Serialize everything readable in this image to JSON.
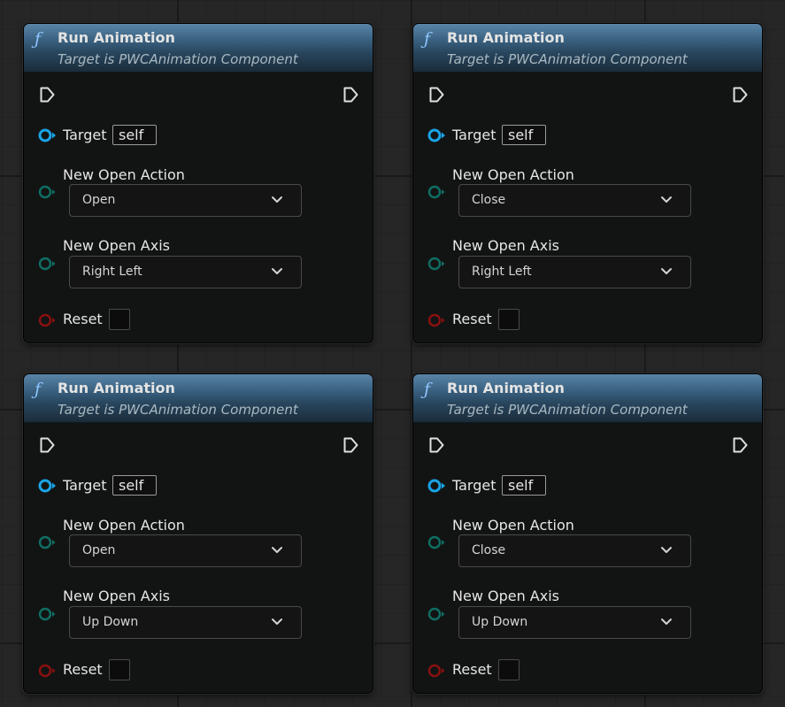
{
  "colors": {
    "exec": "#e0e0e0",
    "object_pin": "#1aa3e6",
    "enum_pin": "#0f6e64",
    "bool_pin": "#8a1010"
  },
  "nodes": [
    {
      "icon": "function-icon",
      "icon_glyph": "ƒ",
      "title": "Run Animation",
      "subtitle": "Target is PWCAnimation Component",
      "target_label": "Target",
      "target_value": "self",
      "action_label": "New Open Action",
      "action_value": "Open",
      "axis_label": "New Open Axis",
      "axis_value": "Right Left",
      "reset_label": "Reset",
      "reset_checked": false
    },
    {
      "icon": "function-icon",
      "icon_glyph": "ƒ",
      "title": "Run Animation",
      "subtitle": "Target is PWCAnimation Component",
      "target_label": "Target",
      "target_value": "self",
      "action_label": "New Open Action",
      "action_value": "Close",
      "axis_label": "New Open Axis",
      "axis_value": "Right Left",
      "reset_label": "Reset",
      "reset_checked": false
    },
    {
      "icon": "function-icon",
      "icon_glyph": "ƒ",
      "title": "Run Animation",
      "subtitle": "Target is PWCAnimation Component",
      "target_label": "Target",
      "target_value": "self",
      "action_label": "New Open Action",
      "action_value": "Open",
      "axis_label": "New Open Axis",
      "axis_value": "Up Down",
      "reset_label": "Reset",
      "reset_checked": false
    },
    {
      "icon": "function-icon",
      "icon_glyph": "ƒ",
      "title": "Run Animation",
      "subtitle": "Target is PWCAnimation Component",
      "target_label": "Target",
      "target_value": "self",
      "action_label": "New Open Action",
      "action_value": "Close",
      "axis_label": "New Open Axis",
      "axis_value": "Up Down",
      "reset_label": "Reset",
      "reset_checked": false
    }
  ]
}
